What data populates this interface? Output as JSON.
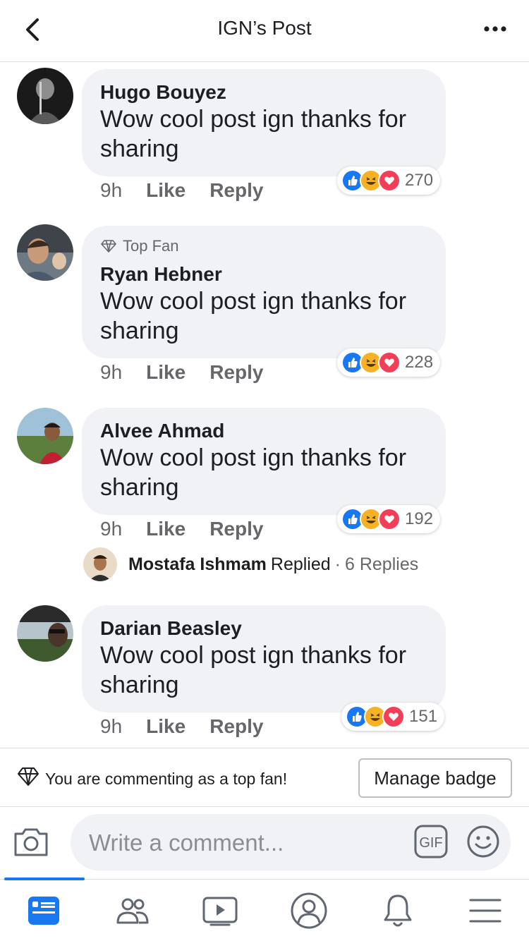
{
  "header": {
    "title": "IGN’s Post"
  },
  "colors": {
    "accent": "#1877f2",
    "like": "#1877f2",
    "love": "#f33e58",
    "haha": "#f7b125"
  },
  "comments": [
    {
      "author": "Hugo Bouyez",
      "top_fan": false,
      "text": "Wow cool post ign thanks for sharing",
      "time": "9h",
      "like": "Like",
      "reply": "Reply",
      "reaction_count": "270"
    },
    {
      "author": "Ryan Hebner",
      "top_fan": true,
      "top_fan_label": "Top Fan",
      "text": "Wow cool post ign thanks for sharing",
      "time": "9h",
      "like": "Like",
      "reply": "Reply",
      "reaction_count": "228"
    },
    {
      "author": "Alvee Ahmad",
      "top_fan": false,
      "text": "Wow cool post ign thanks for sharing",
      "time": "9h",
      "like": "Like",
      "reply": "Reply",
      "reaction_count": "192"
    },
    {
      "author": "Darian Beasley",
      "top_fan": false,
      "text": "Wow cool post ign thanks for sharing",
      "time": "9h",
      "like": "Like",
      "reply": "Reply",
      "reaction_count": "151"
    }
  ],
  "reply_summary": {
    "name": "Mostafa Ishmam",
    "replied": "Replied",
    "dot": "·",
    "count": "6 Replies"
  },
  "topfan_bar": {
    "text": "You are commenting as a top fan!",
    "button": "Manage badge"
  },
  "composer": {
    "placeholder": "Write a comment..."
  },
  "tabs": [
    {
      "icon": "news-feed-icon",
      "active": true
    },
    {
      "icon": "friends-icon",
      "active": false
    },
    {
      "icon": "watch-icon",
      "active": false
    },
    {
      "icon": "profile-icon",
      "active": false
    },
    {
      "icon": "notifications-icon",
      "active": false
    },
    {
      "icon": "menu-icon",
      "active": false
    }
  ]
}
